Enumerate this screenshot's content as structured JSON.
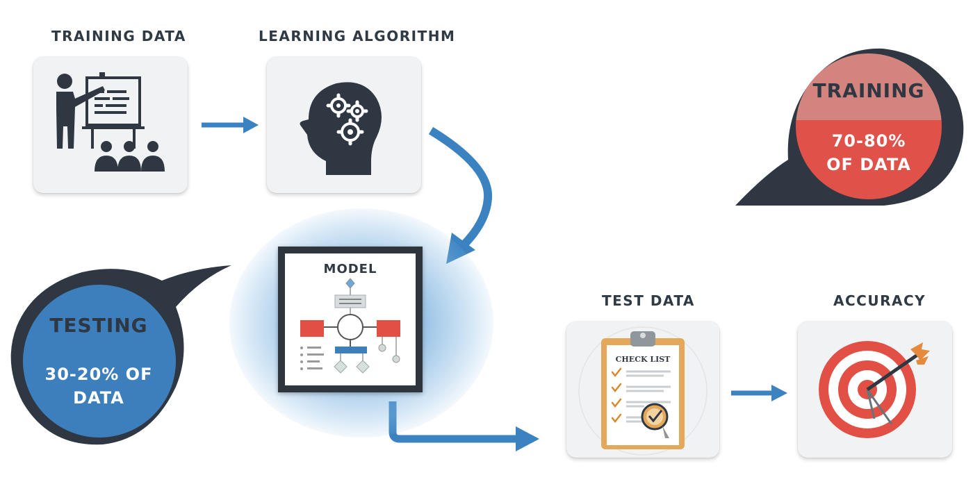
{
  "labels": {
    "training_data": "TRAINING DATA",
    "learning_algorithm": "LEARNING ALGORITHM",
    "model": "MODEL",
    "test_data": "TEST DATA",
    "accuracy": "ACCURACY"
  },
  "checklist_title": "CHECK LIST",
  "training_bubble": {
    "title": "TRAINING",
    "value": "70-80% OF DATA",
    "top_color": "#d4847f",
    "bottom_color": "#e0514a",
    "ring_color": "#2e3742"
  },
  "testing_bubble": {
    "title": "TESTING",
    "value": "30-20% OF DATA",
    "fill_color": "#3d7fbd",
    "ring_color": "#2e3742"
  },
  "colors": {
    "arrow": "#3b83c0",
    "dark": "#2e3742",
    "card": "#f1f2f4"
  },
  "icons": [
    "presentation-icon",
    "brain-gears-icon",
    "flowchart-icon",
    "clipboard-checklist-icon",
    "target-arrow-icon"
  ]
}
